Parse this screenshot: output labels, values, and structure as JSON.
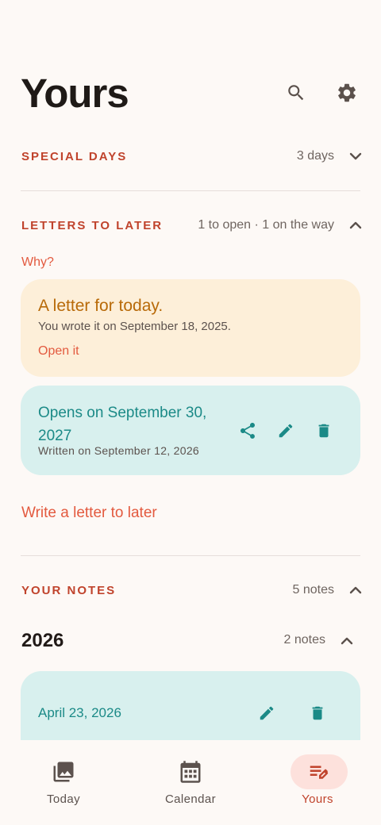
{
  "header": {
    "title": "Yours"
  },
  "special_days": {
    "label": "SPECIAL DAYS",
    "meta": "3 days"
  },
  "letters": {
    "label": "LETTERS TO LATER",
    "meta": "1 to open · 1 on the way",
    "why_link": "Why?",
    "ready_card": {
      "title": "A letter for today.",
      "subtitle": "You wrote it on September 18, 2025.",
      "action": "Open it"
    },
    "pending_card": {
      "title": "Opens on September 30, 2027",
      "subtitle": "Written on September 12, 2026"
    },
    "write_link": "Write a letter to later"
  },
  "notes": {
    "label": "YOUR NOTES",
    "meta": "5 notes",
    "year": "2026",
    "year_meta": "2 notes",
    "entry_date": "April 23, 2026"
  },
  "nav": {
    "items": [
      {
        "label": "Today"
      },
      {
        "label": "Calendar"
      },
      {
        "label": "Yours"
      }
    ]
  },
  "colors": {
    "accent": "#c0432c",
    "link": "#e35a3f",
    "teal": "#1b8a87",
    "orange_card": "#fdefd9",
    "teal_card": "#d8f0ee",
    "active_nav": "#fde1dc"
  }
}
